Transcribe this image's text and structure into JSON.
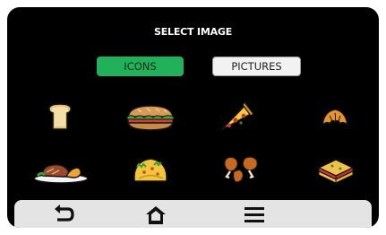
{
  "header": {
    "title": "SELECT IMAGE"
  },
  "tabs": {
    "icons_label": "ICONS",
    "pictures_label": "PICTURES",
    "active": "ICONS"
  },
  "grid": {
    "items": [
      {
        "icon": "toast-icon"
      },
      {
        "icon": "sub-sandwich-icon"
      },
      {
        "icon": "pizza-slice-icon"
      },
      {
        "icon": "croissant-icon"
      },
      {
        "icon": "steak-plate-icon"
      },
      {
        "icon": "taco-icon"
      },
      {
        "icon": "chicken-wings-icon"
      },
      {
        "icon": "lasagna-icon"
      }
    ]
  },
  "navbar": {
    "buttons": [
      {
        "icon": "back-icon"
      },
      {
        "icon": "home-icon"
      },
      {
        "icon": "menu-icon"
      }
    ]
  },
  "colors": {
    "screen": "#000000",
    "active_tab": "#21b15a",
    "inactive_tab": "#f2f2f2",
    "navbar": "#e4e4e4"
  }
}
